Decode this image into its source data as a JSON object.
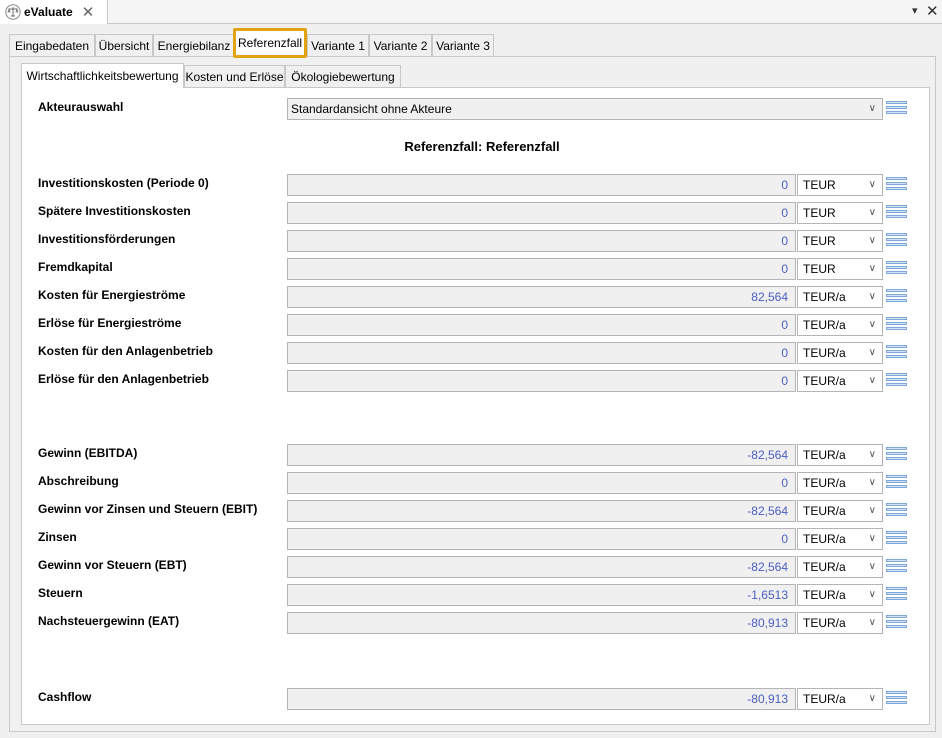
{
  "window": {
    "title": "eValuate",
    "close_glyph": "✕",
    "menu_glyph": "▾",
    "window_close_glyph": "✕"
  },
  "outer_tabs": [
    "Eingabedaten",
    "Übersicht",
    "Energiebilanz",
    "Referenzfall",
    "Variante 1",
    "Variante 2",
    "Variante 3"
  ],
  "inner_tabs": [
    "Wirtschaftlichkeitsbewertung",
    "Kosten und Erlöse",
    "Ökologiebewertung"
  ],
  "actor": {
    "label": "Akteurauswahl",
    "selected": "Standardansicht ohne Akteure"
  },
  "heading": "Referenzfall: Referenzfall",
  "rows": [
    {
      "label": "Investitionskosten (Periode 0)",
      "value": "0",
      "unit": "TEUR"
    },
    {
      "label": "Spätere Investitionskosten",
      "value": "0",
      "unit": "TEUR"
    },
    {
      "label": "Investitionsförderungen",
      "value": "0",
      "unit": "TEUR"
    },
    {
      "label": "Fremdkapital",
      "value": "0",
      "unit": "TEUR"
    },
    {
      "label": "Kosten für Energieströme",
      "value": "82,564",
      "unit": "TEUR/a"
    },
    {
      "label": "Erlöse für Energieströme",
      "value": "0",
      "unit": "TEUR/a"
    },
    {
      "label": "Kosten für den Anlagenbetrieb",
      "value": "0",
      "unit": "TEUR/a"
    },
    {
      "label": "Erlöse für den Anlagenbetrieb",
      "value": "0",
      "unit": "TEUR/a"
    },
    {
      "label": "Gewinn (EBITDA)",
      "value": "-82,564",
      "unit": "TEUR/a"
    },
    {
      "label": "Abschreibung",
      "value": "0",
      "unit": "TEUR/a"
    },
    {
      "label": "Gewinn vor Zinsen und Steuern (EBIT)",
      "value": "-82,564",
      "unit": "TEUR/a"
    },
    {
      "label": "Zinsen",
      "value": "0",
      "unit": "TEUR/a"
    },
    {
      "label": "Gewinn vor Steuern (EBT)",
      "value": "-82,564",
      "unit": "TEUR/a"
    },
    {
      "label": "Steuern",
      "value": "-1,6513",
      "unit": "TEUR/a"
    },
    {
      "label": "Nachsteuergewinn (EAT)",
      "value": "-80,913",
      "unit": "TEUR/a"
    },
    {
      "label": "Cashflow",
      "value": "-80,913",
      "unit": "TEUR/a"
    }
  ],
  "icons": {
    "app": "balance-scale-icon",
    "dropdown": "chevron-down-icon",
    "row_menu": "list-menu-icon"
  },
  "colors": {
    "active_tab_border": "#e2a311",
    "value_text": "#4b5dc2"
  }
}
